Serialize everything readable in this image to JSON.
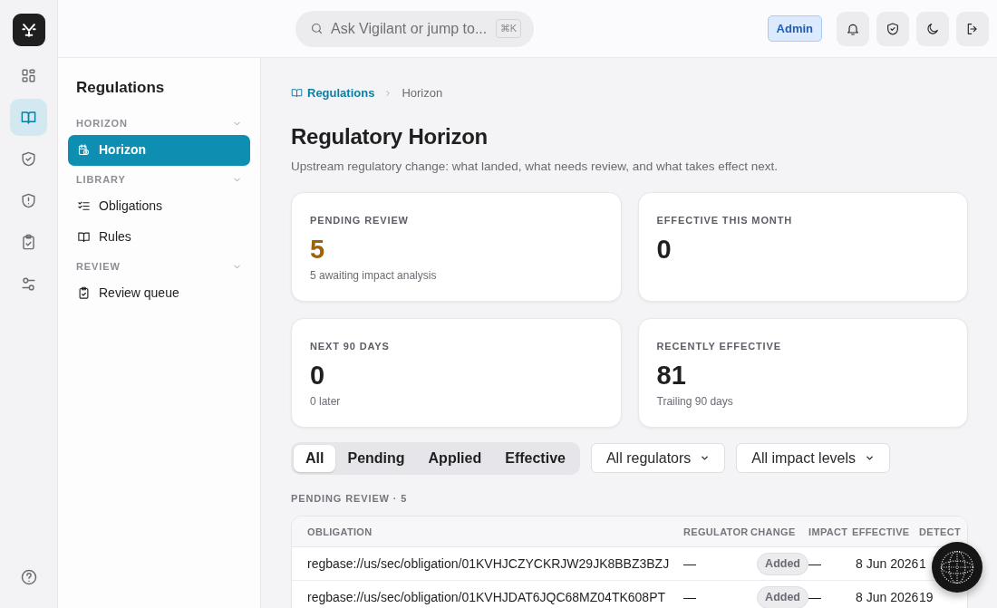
{
  "rail": {
    "items": [
      {
        "selected": false
      },
      {
        "selected": true
      },
      {
        "selected": false
      },
      {
        "selected": false
      },
      {
        "selected": false
      },
      {
        "selected": false
      }
    ]
  },
  "topbar": {
    "search": {
      "placeholder": "Ask Vigilant or jump to...",
      "shortcut": "⌘K"
    },
    "role_badge": "Admin"
  },
  "sidebar": {
    "title": "Regulations",
    "sections": [
      {
        "label": "HORIZON",
        "expanded": true,
        "items": [
          {
            "label": "Horizon",
            "selected": true
          }
        ]
      },
      {
        "label": "LIBRARY",
        "expanded": true,
        "items": [
          {
            "label": "Obligations",
            "selected": false
          },
          {
            "label": "Rules",
            "selected": false
          }
        ]
      },
      {
        "label": "REVIEW",
        "expanded": true,
        "items": [
          {
            "label": "Review queue",
            "selected": false
          }
        ]
      }
    ]
  },
  "breadcrumb": {
    "parent": "Regulations",
    "current": "Horizon"
  },
  "page": {
    "title": "Regulatory Horizon",
    "subtitle": "Upstream regulatory change: what landed, what needs review, and what takes effect next."
  },
  "stats": [
    {
      "label": "PENDING REVIEW",
      "value": "5",
      "note": "5 awaiting impact analysis",
      "color": "#a16207"
    },
    {
      "label": "EFFECTIVE THIS MONTH",
      "value": "0",
      "color": "#1f1f1f"
    },
    {
      "label": "NEXT 90 DAYS",
      "value": "0",
      "note": "0 later",
      "color": "#1f1f1f"
    },
    {
      "label": "RECENTLY EFFECTIVE",
      "value": "81",
      "note": "Trailing 90 days",
      "color": "#1f1f1f"
    }
  ],
  "filters": {
    "tabs": [
      {
        "label": "All",
        "selected": true
      },
      {
        "label": "Pending",
        "selected": false
      },
      {
        "label": "Applied",
        "selected": false
      },
      {
        "label": "Effective",
        "selected": false
      }
    ],
    "selects": [
      "All regulators",
      "All impact levels"
    ]
  },
  "section_label": "PENDING REVIEW · 5",
  "table": {
    "columns": [
      "OBLIGATION",
      "REGULATOR",
      "CHANGE",
      "IMPACT",
      "EFFECTIVE",
      "DETECT"
    ],
    "rows": [
      {
        "obligation": "regbase://us/sec/obligation/01KVHJCZYCKRJW29JK8BBZ3BZJ",
        "regulator": "—",
        "change": "Added",
        "impact": "—",
        "effective": "8 Jun 2026",
        "detected": "1"
      },
      {
        "obligation": "regbase://us/sec/obligation/01KVHJDAT6JQC68MZ04TK608PT",
        "regulator": "—",
        "change": "Added",
        "impact": "—",
        "effective": "8 Jun 2026",
        "detected": "19"
      }
    ]
  }
}
